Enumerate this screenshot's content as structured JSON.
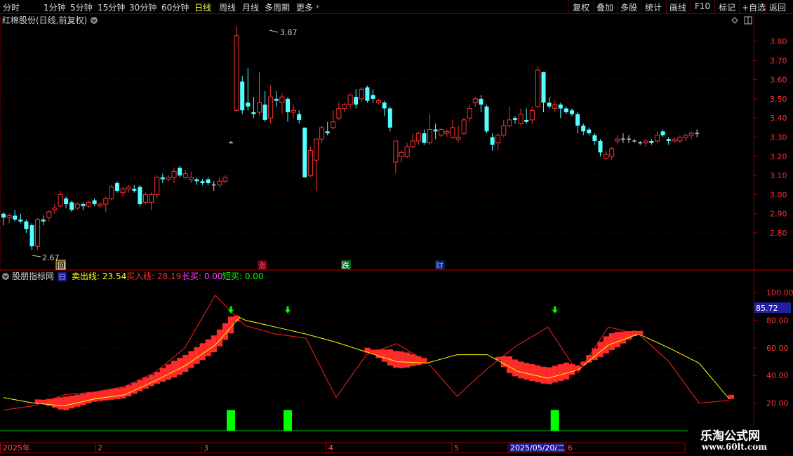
{
  "toolbar": {
    "left": [
      "分时",
      "1分钟",
      "5分钟",
      "15分钟",
      "30分钟",
      "60分钟",
      "日线",
      "周线",
      "月线",
      "多周期",
      "更多"
    ],
    "active": "日线",
    "right": [
      "复权",
      "叠加",
      "多股",
      "统计",
      "画线",
      "F10",
      "标记",
      "+自选",
      "返回"
    ]
  },
  "main_title": "红棉股份(日线,前复权)",
  "max_label": "3.87",
  "min_label": "2.67",
  "events": [
    "回",
    "涨",
    "跌",
    "财"
  ],
  "indicator": {
    "name": "股朋指标网",
    "legend": [
      {
        "label": "卖出线: 23.54",
        "color": "#ffff00"
      },
      {
        "label": "买入线: 28.19",
        "color": "#ff3030"
      },
      {
        "label": "长买: 0.00",
        "color": "#ff40ff"
      },
      {
        "label": "短买: 0.00",
        "color": "#00ff00"
      }
    ],
    "current_value": "85.72"
  },
  "date_axis": {
    "labels": [
      "2025年",
      "2",
      "3",
      "4",
      "5",
      "2025/05/20/二",
      "6"
    ]
  },
  "watermark": {
    "line1": "乐淘公式网",
    "line2": "www.60lt.com"
  },
  "chart_data": [
    {
      "type": "candlestick",
      "title": "红棉股份(日线,前复权)",
      "y_ticks": [
        3.8,
        3.7,
        3.6,
        3.5,
        3.4,
        3.3,
        3.2,
        3.1,
        3.0,
        2.9,
        2.8
      ],
      "ylim": [
        2.7,
        3.88
      ],
      "grid": true,
      "candles": [
        [
          2.9,
          2.91,
          2.84,
          2.88
        ],
        [
          2.88,
          2.9,
          2.85,
          2.89
        ],
        [
          2.89,
          2.92,
          2.86,
          2.87
        ],
        [
          2.87,
          2.9,
          2.85,
          2.86
        ],
        [
          2.86,
          2.87,
          2.8,
          2.82
        ],
        [
          2.84,
          2.85,
          2.71,
          2.73
        ],
        [
          2.73,
          2.88,
          2.71,
          2.87
        ],
        [
          2.87,
          2.89,
          2.84,
          2.86
        ],
        [
          2.88,
          2.92,
          2.86,
          2.91
        ],
        [
          2.92,
          2.95,
          2.9,
          2.93
        ],
        [
          2.94,
          3.02,
          2.93,
          3.0
        ],
        [
          2.98,
          2.99,
          2.93,
          2.95
        ],
        [
          2.96,
          2.97,
          2.91,
          2.92
        ],
        [
          2.93,
          2.96,
          2.92,
          2.95
        ],
        [
          2.95,
          2.96,
          2.92,
          2.94
        ],
        [
          2.94,
          2.97,
          2.93,
          2.96
        ],
        [
          2.97,
          2.98,
          2.94,
          2.95
        ],
        [
          2.94,
          2.96,
          2.93,
          2.95
        ],
        [
          2.95,
          2.99,
          2.91,
          2.98
        ],
        [
          2.98,
          3.05,
          2.97,
          3.04
        ],
        [
          3.06,
          3.07,
          3.01,
          3.02
        ],
        [
          3.01,
          3.04,
          2.99,
          3.03
        ],
        [
          3.03,
          3.05,
          3.01,
          3.04
        ],
        [
          3.03,
          3.05,
          3.01,
          3.02
        ],
        [
          3.04,
          3.05,
          2.94,
          2.95
        ],
        [
          2.96,
          3.01,
          2.95,
          3.0
        ],
        [
          2.96,
          3.01,
          2.92,
          3.0
        ],
        [
          3.0,
          3.1,
          2.98,
          3.09
        ],
        [
          3.09,
          3.11,
          3.06,
          3.08
        ],
        [
          3.08,
          3.1,
          3.07,
          3.09
        ],
        [
          3.09,
          3.14,
          3.06,
          3.12
        ],
        [
          3.14,
          3.15,
          3.09,
          3.1
        ],
        [
          3.09,
          3.13,
          3.08,
          3.11
        ],
        [
          3.08,
          3.12,
          3.06,
          3.09
        ],
        [
          3.08,
          3.09,
          3.05,
          3.07
        ],
        [
          3.07,
          3.08,
          3.05,
          3.06
        ],
        [
          3.08,
          3.09,
          3.05,
          3.06
        ],
        [
          3.05,
          3.07,
          3.02,
          3.05
        ],
        [
          3.05,
          3.09,
          3.04,
          3.07
        ],
        [
          3.07,
          3.1,
          3.06,
          3.09
        ],
        [
          3.27,
          3.28,
          3.27,
          3.27
        ],
        [
          3.44,
          3.88,
          3.43,
          3.83
        ],
        [
          3.59,
          3.62,
          3.42,
          3.44
        ],
        [
          3.48,
          3.66,
          3.44,
          3.46
        ],
        [
          3.43,
          3.51,
          3.4,
          3.42
        ],
        [
          3.43,
          3.64,
          3.41,
          3.48
        ],
        [
          3.47,
          3.54,
          3.38,
          3.39
        ],
        [
          3.4,
          3.57,
          3.37,
          3.51
        ],
        [
          3.5,
          3.54,
          3.46,
          3.49
        ],
        [
          3.48,
          3.53,
          3.42,
          3.51
        ],
        [
          3.5,
          3.51,
          3.38,
          3.43
        ],
        [
          3.43,
          3.47,
          3.4,
          3.44
        ],
        [
          3.42,
          3.44,
          3.37,
          3.39
        ],
        [
          3.35,
          3.35,
          3.09,
          3.09
        ],
        [
          3.1,
          3.25,
          3.09,
          3.23
        ],
        [
          3.18,
          3.29,
          3.02,
          3.29
        ],
        [
          3.29,
          3.36,
          3.27,
          3.35
        ],
        [
          3.33,
          3.38,
          3.31,
          3.32
        ],
        [
          3.35,
          3.44,
          3.34,
          3.38
        ],
        [
          3.4,
          3.48,
          3.39,
          3.45
        ],
        [
          3.45,
          3.48,
          3.43,
          3.47
        ],
        [
          3.47,
          3.53,
          3.45,
          3.52
        ],
        [
          3.51,
          3.55,
          3.45,
          3.47
        ],
        [
          3.5,
          3.56,
          3.48,
          3.55
        ],
        [
          3.56,
          3.57,
          3.48,
          3.49
        ],
        [
          3.52,
          3.55,
          3.48,
          3.5
        ],
        [
          3.48,
          3.5,
          3.47,
          3.49
        ],
        [
          3.48,
          3.49,
          3.41,
          3.45
        ],
        [
          3.45,
          3.46,
          3.33,
          3.35
        ],
        [
          3.17,
          3.17,
          3.11,
          3.28
        ],
        [
          3.2,
          3.23,
          3.17,
          3.22
        ],
        [
          3.2,
          3.27,
          3.19,
          3.25
        ],
        [
          3.25,
          3.32,
          3.24,
          3.28
        ],
        [
          3.28,
          3.33,
          3.26,
          3.32
        ],
        [
          3.32,
          3.34,
          3.26,
          3.27
        ],
        [
          3.27,
          3.42,
          3.26,
          3.34
        ],
        [
          3.34,
          3.37,
          3.29,
          3.33
        ],
        [
          3.31,
          3.35,
          3.3,
          3.34
        ],
        [
          3.32,
          3.34,
          3.3,
          3.33
        ],
        [
          3.3,
          3.39,
          3.29,
          3.35
        ],
        [
          3.29,
          3.36,
          3.27,
          3.3
        ],
        [
          3.32,
          3.4,
          3.31,
          3.39
        ],
        [
          3.4,
          3.47,
          3.38,
          3.45
        ],
        [
          3.48,
          3.51,
          3.46,
          3.5
        ],
        [
          3.5,
          3.52,
          3.43,
          3.47
        ],
        [
          3.46,
          3.47,
          3.32,
          3.33
        ],
        [
          3.3,
          3.32,
          3.23,
          3.26
        ],
        [
          3.27,
          3.32,
          3.23,
          3.31
        ],
        [
          3.31,
          3.39,
          3.3,
          3.36
        ],
        [
          3.36,
          3.46,
          3.35,
          3.39
        ],
        [
          3.4,
          3.41,
          3.37,
          3.39
        ],
        [
          3.37,
          3.45,
          3.36,
          3.42
        ],
        [
          3.39,
          3.45,
          3.37,
          3.38
        ],
        [
          3.39,
          3.46,
          3.37,
          3.44
        ],
        [
          3.46,
          3.67,
          3.45,
          3.65
        ],
        [
          3.64,
          3.64,
          3.43,
          3.48
        ],
        [
          3.48,
          3.51,
          3.45,
          3.46
        ],
        [
          3.45,
          3.49,
          3.43,
          3.47
        ],
        [
          3.47,
          3.48,
          3.4,
          3.45
        ],
        [
          3.45,
          3.46,
          3.42,
          3.43
        ],
        [
          3.44,
          3.45,
          3.41,
          3.42
        ],
        [
          3.42,
          3.43,
          3.32,
          3.36
        ],
        [
          3.36,
          3.37,
          3.31,
          3.33
        ],
        [
          3.34,
          3.35,
          3.31,
          3.32
        ],
        [
          3.31,
          3.32,
          3.26,
          3.28
        ],
        [
          3.28,
          3.29,
          3.2,
          3.22
        ],
        [
          3.19,
          3.23,
          3.18,
          3.21
        ],
        [
          3.2,
          3.25,
          3.18,
          3.24
        ],
        [
          3.28,
          3.31,
          3.26,
          3.29
        ],
        [
          3.29,
          3.32,
          3.27,
          3.29
        ],
        [
          3.29,
          3.31,
          3.27,
          3.29
        ],
        [
          3.28,
          3.29,
          3.27,
          3.28
        ],
        [
          3.27,
          3.28,
          3.26,
          3.27
        ],
        [
          3.27,
          3.29,
          3.25,
          3.28
        ],
        [
          3.28,
          3.29,
          3.26,
          3.27
        ],
        [
          3.28,
          3.33,
          3.27,
          3.31
        ],
        [
          3.33,
          3.34,
          3.3,
          3.31
        ],
        [
          3.29,
          3.3,
          3.26,
          3.28
        ],
        [
          3.28,
          3.3,
          3.27,
          3.29
        ],
        [
          3.28,
          3.31,
          3.27,
          3.3
        ],
        [
          3.3,
          3.32,
          3.28,
          3.31
        ],
        [
          3.31,
          3.33,
          3.29,
          3.32
        ],
        [
          3.32,
          3.34,
          3.3,
          3.32
        ]
      ]
    },
    {
      "type": "line",
      "title": "股朋指标网",
      "y_ticks": [
        100,
        80,
        60,
        40,
        20
      ],
      "ylim": [
        0,
        115
      ],
      "series": [
        {
          "name": "卖出线",
          "color": "#ffff00",
          "x": [
            0,
            5,
            10,
            15,
            20,
            25,
            30,
            35,
            39,
            40,
            45,
            50,
            55,
            60,
            65,
            70,
            75,
            80,
            85,
            90,
            95,
            100,
            105,
            110,
            115,
            120
          ],
          "values": [
            24,
            20,
            18,
            23,
            26,
            36,
            47,
            62,
            82,
            80,
            75,
            70,
            64,
            57,
            50,
            49,
            55,
            55,
            43,
            38,
            44,
            62,
            70,
            60,
            49,
            23
          ]
        },
        {
          "name": "买入线",
          "color": "#ff2020",
          "x": [
            0,
            5,
            10,
            15,
            20,
            25,
            30,
            35,
            39,
            40,
            45,
            50,
            55,
            60,
            65,
            70,
            75,
            80,
            85,
            90,
            95,
            100,
            105,
            110,
            115,
            120
          ],
          "values": [
            15,
            18,
            26,
            28,
            32,
            42,
            60,
            98,
            80,
            76,
            70,
            67,
            24,
            55,
            63,
            50,
            25,
            45,
            62,
            75,
            42,
            75,
            70,
            50,
            20,
            22
          ]
        }
      ],
      "bars": [
        {
          "x": 40,
          "value": 15,
          "color": "#00ff00"
        },
        {
          "x": 50,
          "value": 15,
          "color": "#00ff00"
        },
        {
          "x": 97,
          "value": 15,
          "color": "#00ff00"
        }
      ]
    }
  ]
}
